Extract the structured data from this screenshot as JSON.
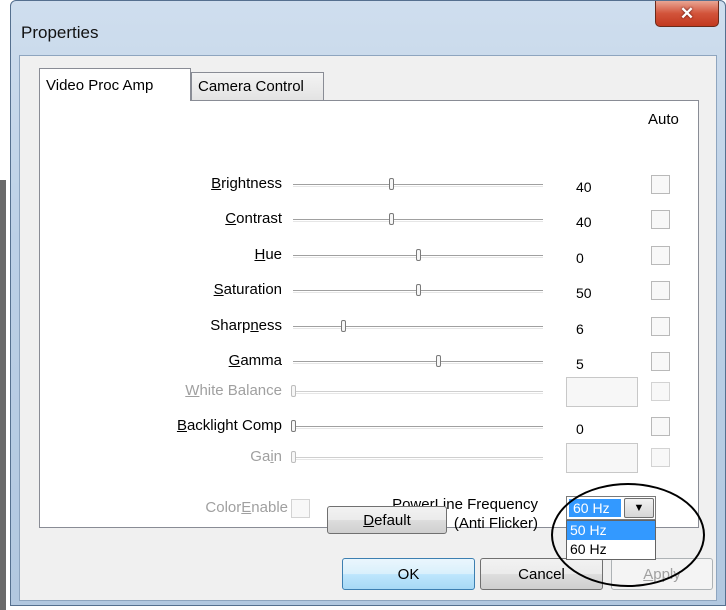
{
  "window": {
    "title": "Properties",
    "close_glyph": "✕"
  },
  "tabs": [
    {
      "label": "Video Proc Amp",
      "active": true
    },
    {
      "label": "Camera Control",
      "active": false
    }
  ],
  "auto_header": "Auto",
  "rows": [
    {
      "pre": "",
      "key": "B",
      "post": "rightness",
      "value": "40",
      "enabled": true,
      "slider_fraction": 0.39
    },
    {
      "pre": "",
      "key": "C",
      "post": "ontrast",
      "value": "40",
      "enabled": true,
      "slider_fraction": 0.39
    },
    {
      "pre": "",
      "key": "H",
      "post": "ue",
      "value": "0",
      "enabled": true,
      "slider_fraction": 0.5
    },
    {
      "pre": "",
      "key": "S",
      "post": "aturation",
      "value": "50",
      "enabled": true,
      "slider_fraction": 0.5
    },
    {
      "pre": "Sharp",
      "key": "n",
      "post": "ess",
      "value": "6",
      "enabled": true,
      "slider_fraction": 0.2
    },
    {
      "pre": "",
      "key": "G",
      "post": "amma",
      "value": "5",
      "enabled": true,
      "slider_fraction": 0.58
    },
    {
      "pre": "",
      "key": "W",
      "post": "hite Balance",
      "value": "",
      "enabled": false,
      "slider_fraction": 0.0
    },
    {
      "pre": "",
      "key": "B",
      "post": "acklight Comp",
      "value": "0",
      "enabled": true,
      "slider_fraction": 0.0
    },
    {
      "pre": "Ga",
      "key": "i",
      "post": "n",
      "value": "",
      "enabled": false,
      "slider_fraction": 0.0
    }
  ],
  "color_enable": {
    "pre": "Color",
    "key": "E",
    "post": "nable"
  },
  "powerline": {
    "line1_pre": "",
    "line1_key": "P",
    "line1_post": "owerLine Frequency",
    "line2": "(Anti Flicker)",
    "selected": "60 Hz",
    "options": [
      "50 Hz",
      "60 Hz"
    ],
    "highlighted": "50 Hz"
  },
  "default_button": {
    "pre": "",
    "key": "D",
    "post": "efault"
  },
  "footer": {
    "ok": "OK",
    "cancel": "Cancel",
    "apply_pre": "",
    "apply_key": "A",
    "apply_post": "pply"
  }
}
